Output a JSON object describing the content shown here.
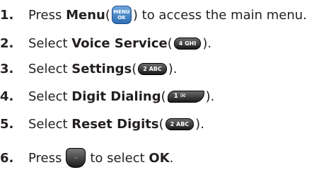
{
  "steps": [
    {
      "num": "1.",
      "pre": "Press ",
      "bold": "Menu",
      "open": " (",
      "key": {
        "line1": "MENU",
        "line2": "OK"
      },
      "post": ") to access the main menu."
    },
    {
      "num": "2.",
      "pre": "Select ",
      "bold": "Voice Service",
      "open": " (",
      "key": {
        "label": "4 GHI"
      },
      "post": ")."
    },
    {
      "num": "3.",
      "pre": "Select ",
      "bold": "Settings",
      "open": " (",
      "key": {
        "label": "2 ABC"
      },
      "post": ")."
    },
    {
      "num": "4.",
      "pre": "Select ",
      "bold": "Digit Dialing",
      "open": " (",
      "key": {
        "label": "1 ✉"
      },
      "post": ")."
    },
    {
      "num": "5.",
      "pre": "Select ",
      "bold": "Reset Digits",
      "open": " (",
      "key": {
        "label": "2 ABC"
      },
      "post": ")."
    },
    {
      "num": "6.",
      "pre": "Press ",
      "key": {
        "label": "··"
      },
      "post": "to select ",
      "bold_end": "OK",
      "end": "."
    }
  ]
}
